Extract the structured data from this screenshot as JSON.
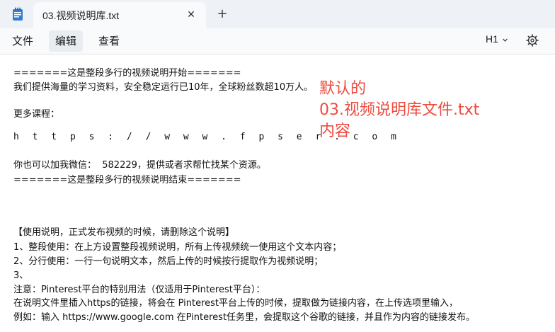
{
  "tab": {
    "title": "03.视频说明库.txt",
    "close_label": "✕",
    "new_tab_label": "+"
  },
  "menu": {
    "file": "文件",
    "edit": "编辑",
    "view": "查看",
    "heading_level": "H1"
  },
  "document": {
    "lines": [
      "=======这是整段多行的视频说明开始=======",
      "我们提供海量的学习资料，安全稳定运行已10年，全球粉丝数超10万人。",
      "",
      "更多课程：",
      "",
      "h t t p s : / / w w w . f p s e r . c o m",
      "",
      "你也可以加我微信：  582229，提供或者求帮忙找某个资源。",
      "=======这是整段多行的视频说明结束=======",
      "",
      "",
      "",
      "【使用说明，正式发布视频的时候，请删除这个说明】",
      "1、整段使用：在上方设置整段视频说明，所有上传视频统一使用这个文本内容；",
      "2、分行使用：一行一句说明文本，然后上传的时候按行提取作为视频说明；",
      "3、",
      "注意：Pinterest平台的特别用法（仅适用于Pinterest平台）：",
      "在说明文件里插入https的链接，将会在 Pinterest平台上传的时候，提取做为链接内容，在上传选项里输入，",
      "例如：输入 https://www.google.com 在Pinterest任务里，会提取这个谷歌的链接，并且作为内容的链接发布。"
    ]
  },
  "annotation": {
    "line1": "默认的",
    "line2": "03.视频说明库文件.txt",
    "line3": "内容"
  },
  "colors": {
    "annotation": "#ee4b3f",
    "titlebar": "#eef1f6",
    "app_icon": "#2d7fd3"
  },
  "icons": {
    "app": "notepad-icon",
    "close": "close-icon",
    "new_tab": "plus-icon",
    "heading_caret": "chevron-down-icon",
    "settings": "gear-icon"
  }
}
